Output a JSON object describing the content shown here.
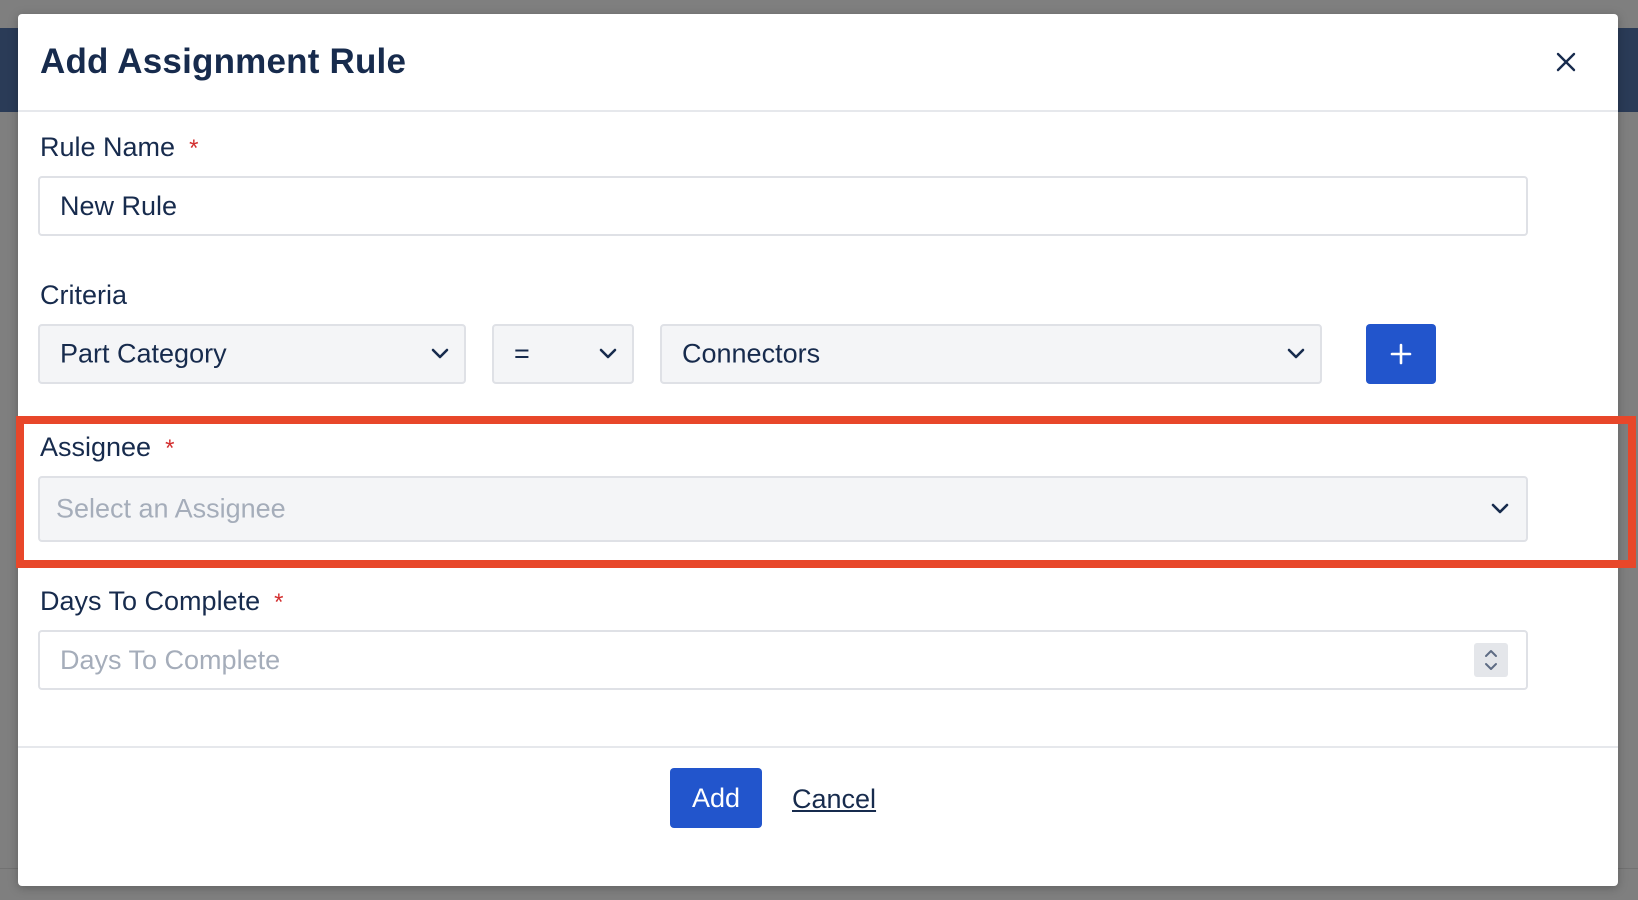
{
  "modal": {
    "title": "Add Assignment Rule",
    "close_icon": "close-icon"
  },
  "rule_name": {
    "label": "Rule Name",
    "required_marker": "*",
    "value": "New Rule"
  },
  "criteria": {
    "label": "Criteria",
    "field_select": "Part Category",
    "operator_select": "=",
    "value_select": "Connectors",
    "add_icon": "plus-icon"
  },
  "assignee": {
    "label": "Assignee",
    "required_marker": "*",
    "placeholder": "Select an Assignee"
  },
  "days_to_complete": {
    "label": "Days To Complete",
    "required_marker": "*",
    "placeholder": "Days To Complete"
  },
  "footer": {
    "add_label": "Add",
    "cancel_label": "Cancel"
  },
  "colors": {
    "primary_button": "#2255cc",
    "highlight": "#e8472a",
    "required_marker": "#d32f2f",
    "text": "#172b4d"
  }
}
